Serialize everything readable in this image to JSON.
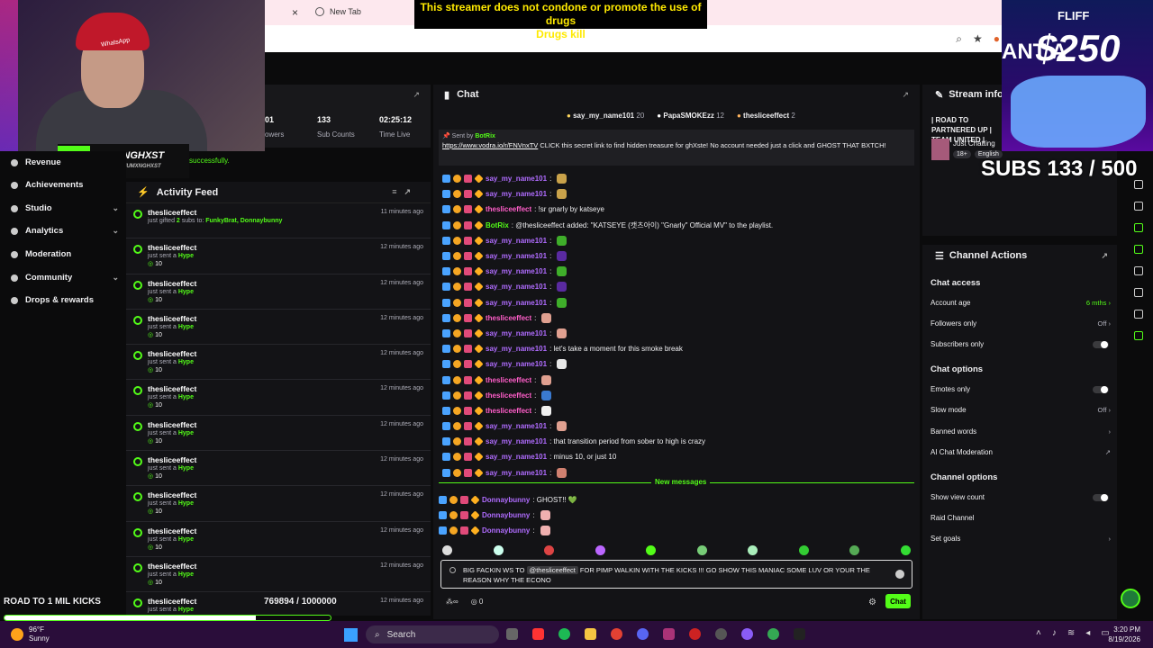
{
  "browser": {
    "tab_close": "×",
    "new_tab": "New Tab"
  },
  "overlay": {
    "disclaimer_line1": "This streamer does not condone or promote the use of drugs",
    "disclaimer_line2": "Drugs kill",
    "brand_name": "HUMXNGHXST",
    "brand_sub": "KICK.COM/HUMXNGHXST",
    "cap_text": "WhatsApp",
    "fliff_logo": "FLIFF",
    "fliff_prize": "$250",
    "fliff_side": "ANT A",
    "subs": "SUBS 133 / 500",
    "success": "successfully."
  },
  "nav": {
    "items": [
      {
        "label": "Revenue",
        "icon": "dollar-icon"
      },
      {
        "label": "Achievements",
        "icon": "star-icon"
      },
      {
        "label": "Studio",
        "icon": "camera-icon"
      },
      {
        "label": "Analytics",
        "icon": "chart-icon"
      },
      {
        "label": "Moderation",
        "icon": "hammer-icon"
      },
      {
        "label": "Community",
        "icon": "people-icon"
      },
      {
        "label": "Drops & rewards",
        "icon": "gift-icon"
      }
    ],
    "chevron": "⌄"
  },
  "stats": {
    "followers_value": "01",
    "followers_label": "owers",
    "subs_value": "133",
    "subs_label": "Sub Counts",
    "time_value": "02:25:12",
    "time_label": "Time Live"
  },
  "activity": {
    "title": "Activity Feed",
    "rows": [
      {
        "name": "thesliceeffect",
        "pre": "just gifted ",
        "hl": "2",
        "mid": " subs to: ",
        "hl2": "FunkyBrat, Donnaybunny",
        "amt": "",
        "time": "11 minutes ago"
      },
      {
        "name": "thesliceeffect",
        "pre": "just sent a ",
        "hl": "Hype",
        "mid": "",
        "hl2": "",
        "amt": "10",
        "time": "12 minutes ago"
      },
      {
        "name": "thesliceeffect",
        "pre": "just sent a ",
        "hl": "Hype",
        "mid": "",
        "hl2": "",
        "amt": "10",
        "time": "12 minutes ago"
      },
      {
        "name": "thesliceeffect",
        "pre": "just sent a ",
        "hl": "Hype",
        "mid": "",
        "hl2": "",
        "amt": "10",
        "time": "12 minutes ago"
      },
      {
        "name": "thesliceeffect",
        "pre": "just sent a ",
        "hl": "Hype",
        "mid": "",
        "hl2": "",
        "amt": "10",
        "time": "12 minutes ago"
      },
      {
        "name": "thesliceeffect",
        "pre": "just sent a ",
        "hl": "Hype",
        "mid": "",
        "hl2": "",
        "amt": "10",
        "time": "12 minutes ago"
      },
      {
        "name": "thesliceeffect",
        "pre": "just sent a ",
        "hl": "Hype",
        "mid": "",
        "hl2": "",
        "amt": "10",
        "time": "12 minutes ago"
      },
      {
        "name": "thesliceeffect",
        "pre": "just sent a ",
        "hl": "Hype",
        "mid": "",
        "hl2": "",
        "amt": "10",
        "time": "12 minutes ago"
      },
      {
        "name": "thesliceeffect",
        "pre": "just sent a ",
        "hl": "Hype",
        "mid": "",
        "hl2": "",
        "amt": "10",
        "time": "12 minutes ago"
      },
      {
        "name": "thesliceeffect",
        "pre": "just sent a ",
        "hl": "Hype",
        "mid": "",
        "hl2": "",
        "amt": "10",
        "time": "12 minutes ago"
      },
      {
        "name": "thesliceeffect",
        "pre": "just sent a ",
        "hl": "Hype",
        "mid": "",
        "hl2": "",
        "amt": "10",
        "time": "12 minutes ago"
      },
      {
        "name": "thesliceeffect",
        "pre": "just sent a ",
        "hl": "Hype",
        "mid": "",
        "hl2": "",
        "amt": "10",
        "time": "12 minutes ago"
      }
    ]
  },
  "goal": {
    "label": "ROAD TO 1 MIL KICKS",
    "count": "769894 / 1000000",
    "fraction": 0.7699
  },
  "chat": {
    "title": "Chat",
    "leaders": [
      {
        "name": "say_my_name101",
        "count": "20",
        "color": "#ffd75e"
      },
      {
        "name": "PapaSMOKEzz",
        "count": "12",
        "color": "#ffffff"
      },
      {
        "name": "thesliceeffect",
        "count": "2",
        "color": "#ffb45e"
      }
    ],
    "pinned_by_label": "Sent by",
    "pinned_by_user": "BotRix",
    "pinned_link": "https://www.vodra.io/r/FNVnxTV",
    "pinned_text": " CLICK this secret link to find hidden treasure for ghXste! No account needed just a click and GHOST THAT BXTCH!",
    "messages": [
      {
        "user": "say_my_name101",
        "color": "#b06cff",
        "text": ":",
        "emote": "#c9a24a"
      },
      {
        "user": "say_my_name101",
        "color": "#b06cff",
        "text": ":",
        "emote": "#c9a24a"
      },
      {
        "user": "thesliceeffect",
        "color": "#ff5ec9",
        "text": ": !sr gnarly by katseye",
        "emote": ""
      },
      {
        "user": "BotRix",
        "color": "#53fc18",
        "text": ": @thesliceeffect added: \"KATSEYE (캣츠아이) \"Gnarly\" Official MV\" to the playlist.",
        "emote": ""
      },
      {
        "user": "say_my_name101",
        "color": "#b06cff",
        "text": ":",
        "emote": "#3fae2a"
      },
      {
        "user": "say_my_name101",
        "color": "#b06cff",
        "text": ":",
        "emote": "#5a2aa0"
      },
      {
        "user": "say_my_name101",
        "color": "#b06cff",
        "text": ":",
        "emote": "#3fae2a"
      },
      {
        "user": "say_my_name101",
        "color": "#b06cff",
        "text": ":",
        "emote": "#5a2aa0"
      },
      {
        "user": "say_my_name101",
        "color": "#b06cff",
        "text": ":",
        "emote": "#3fae2a"
      },
      {
        "user": "thesliceeffect",
        "color": "#ff5ec9",
        "text": ":",
        "emote": "#e0a090"
      },
      {
        "user": "say_my_name101",
        "color": "#b06cff",
        "text": ":",
        "emote": "#e0a090"
      },
      {
        "user": "say_my_name101",
        "color": "#b06cff",
        "text": ": let's take a moment for this smoke break",
        "emote": ""
      },
      {
        "user": "say_my_name101",
        "color": "#b06cff",
        "text": ":",
        "emote": "#e8e8e8"
      },
      {
        "user": "thesliceeffect",
        "color": "#ff5ec9",
        "text": ":",
        "emote": "#e0a090"
      },
      {
        "user": "thesliceeffect",
        "color": "#ff5ec9",
        "text": ":",
        "emote": "#3a7ad0"
      },
      {
        "user": "thesliceeffect",
        "color": "#ff5ec9",
        "text": ":",
        "emote": "#f0f0f0"
      },
      {
        "user": "say_my_name101",
        "color": "#b06cff",
        "text": ":",
        "emote": "#e0a090"
      },
      {
        "user": "say_my_name101",
        "color": "#b06cff",
        "text": ": that transition period from sober to high is crazy",
        "emote": ""
      },
      {
        "user": "say_my_name101",
        "color": "#b06cff",
        "text": ": minus 10, or just 10",
        "emote": ""
      },
      {
        "user": "say_my_name101",
        "color": "#b06cff",
        "text": ":",
        "emote": "#d08070"
      }
    ],
    "new_messages": "New messages",
    "new_msgs": [
      {
        "user": "Donnaybunny",
        "color": "#b06cff",
        "text": ": GHOST!! 💚",
        "emote": ""
      },
      {
        "user": "Donnaybunny",
        "color": "#b06cff",
        "text": ":",
        "emote": "#f0b0b0"
      },
      {
        "user": "Donnaybunny",
        "color": "#b06cff",
        "text": ":",
        "emote": "#f0b0b0"
      }
    ],
    "input_pre": "BIG FACKIN WS TO ",
    "input_mention": "@thesliceeffect",
    "input_post": " FOR PIMP WALKIN WITH THE KICKS !!! GO SHOW THIS MANIAC SOME LUV OR YOUR THE REASON WHY THE ECONO",
    "points": "0",
    "send_label": "Chat"
  },
  "stream_info": {
    "title": "Stream info",
    "stream_title": "| ROAD TO PARTNERED UP | TEAM UNITED |",
    "category": "Just Chatting",
    "tags": [
      "18+",
      "English"
    ]
  },
  "channel_actions": {
    "title": "Channel Actions",
    "chat_access": "Chat access",
    "account_age": "Account age",
    "account_age_val": "6 mths",
    "followers_only": "Followers only",
    "off": "Off",
    "subscribers_only": "Subscribers only",
    "chat_options": "Chat options",
    "emotes_only": "Emotes only",
    "slow_mode": "Slow mode",
    "banned_words": "Banned words",
    "ai_moderation": "AI Chat Moderation",
    "channel_options": "Channel options",
    "show_view_count": "Show view count",
    "raid_channel": "Raid Channel",
    "set_goals": "Set goals"
  },
  "taskbar": {
    "temp": "96°F",
    "weather": "Sunny",
    "search": "Search",
    "time": "3:20 PM",
    "date": "8/19/2026"
  }
}
